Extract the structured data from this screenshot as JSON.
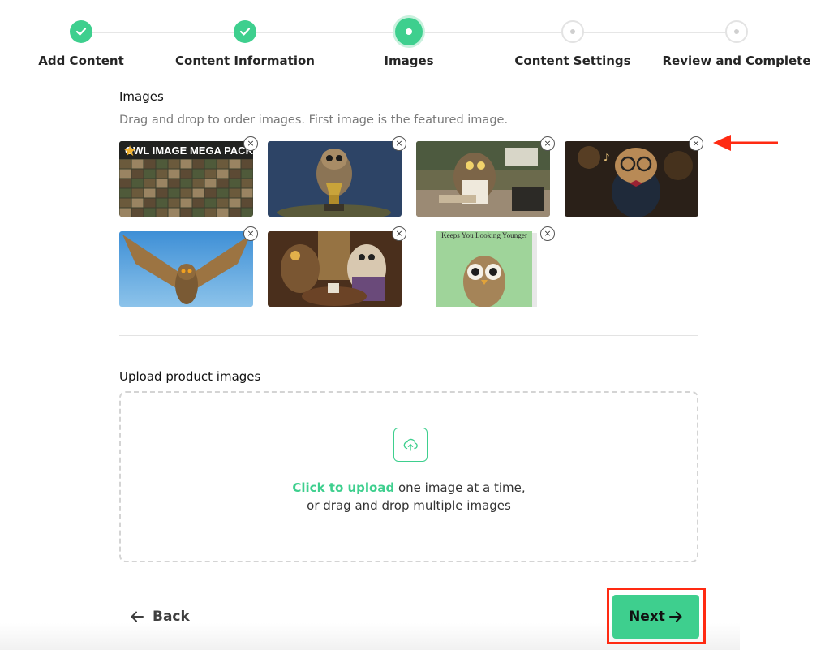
{
  "stepper": {
    "steps": [
      {
        "label": "Add Content",
        "status": "complete"
      },
      {
        "label": "Content Information",
        "status": "complete"
      },
      {
        "label": "Images",
        "status": "current"
      },
      {
        "label": "Content Settings",
        "status": "upcoming"
      },
      {
        "label": "Review and Complete",
        "status": "upcoming"
      }
    ]
  },
  "images": {
    "title": "Images",
    "hint": "Drag and drop to order images. First image is the featured image.",
    "remove_symbol": "×",
    "items": [
      {
        "name": "owl-mega-pack",
        "overlay_text": "OWL IMAGE MEGA PACK",
        "featured": true
      },
      {
        "name": "owl-trophy",
        "overlay_text": ""
      },
      {
        "name": "owl-baker-kitchen",
        "overlay_text": ""
      },
      {
        "name": "owl-singer-glasses",
        "overlay_text": ""
      },
      {
        "name": "owl-flying",
        "overlay_text": ""
      },
      {
        "name": "owls-tea-party",
        "overlay_text": ""
      },
      {
        "name": "owl-book-cover",
        "overlay_text": "Keeps You Looking Younger"
      }
    ]
  },
  "upload": {
    "title": "Upload product images",
    "link_text": "Click to upload",
    "line1_rest": " one image at a time,",
    "line2": "or drag and drop multiple images",
    "icon": "cloud-upload-icon"
  },
  "footer": {
    "back_label": "Back",
    "next_label": "Next"
  },
  "colors": {
    "accent": "#3ecf8e",
    "annotation": "#ff2a12"
  }
}
